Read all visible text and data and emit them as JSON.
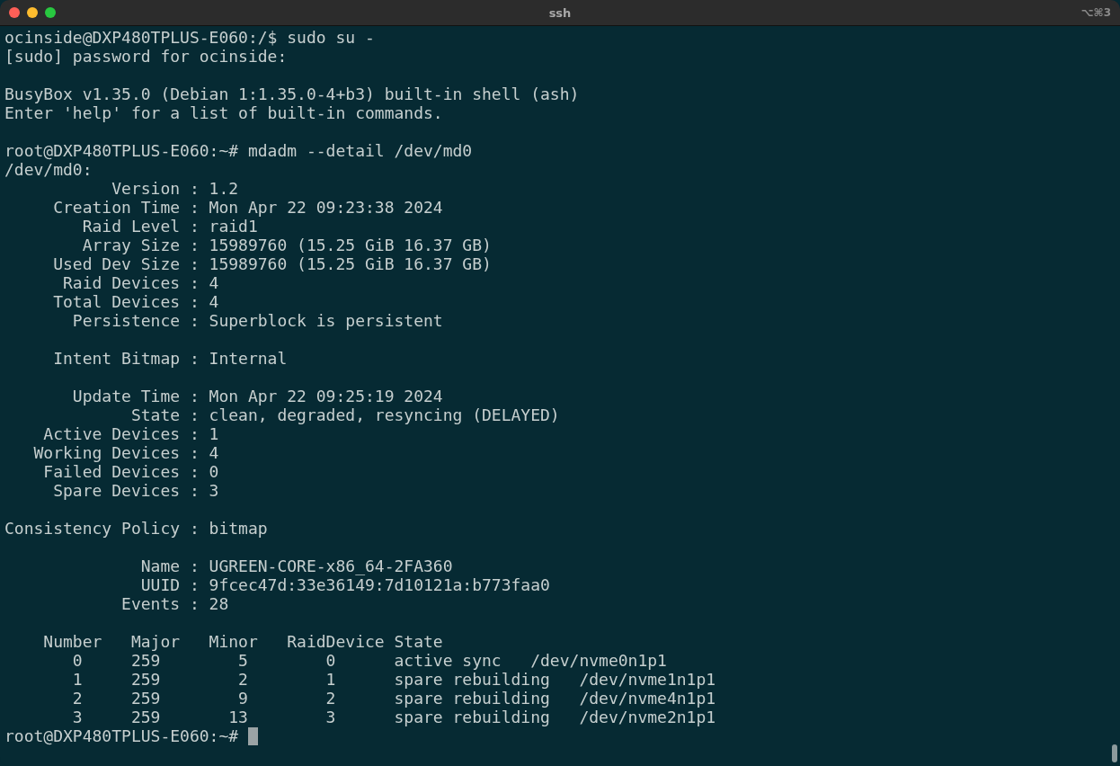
{
  "window": {
    "title": "ssh",
    "shortcut": "⌥⌘3"
  },
  "blocks": [
    {
      "lines": [
        "ocinside@DXP480TPLUS-E060:/$ sudo su -",
        "[sudo] password for ocinside:"
      ]
    },
    {
      "lines": [
        "BusyBox v1.35.0 (Debian 1:1.35.0-4+b3) built-in shell (ash)",
        "Enter 'help' for a list of built-in commands."
      ]
    },
    {
      "lines": [
        "root@DXP480TPLUS-E060:~# mdadm --detail /dev/md0",
        "/dev/md0:",
        "           Version : 1.2",
        "     Creation Time : Mon Apr 22 09:23:38 2024",
        "        Raid Level : raid1",
        "        Array Size : 15989760 (15.25 GiB 16.37 GB)",
        "     Used Dev Size : 15989760 (15.25 GiB 16.37 GB)",
        "      Raid Devices : 4",
        "     Total Devices : 4",
        "       Persistence : Superblock is persistent"
      ]
    },
    {
      "lines": [
        "     Intent Bitmap : Internal"
      ]
    },
    {
      "lines": [
        "       Update Time : Mon Apr 22 09:25:19 2024",
        "             State : clean, degraded, resyncing (DELAYED)",
        "    Active Devices : 1",
        "   Working Devices : 4",
        "    Failed Devices : 0",
        "     Spare Devices : 3"
      ]
    },
    {
      "lines": [
        "Consistency Policy : bitmap"
      ]
    },
    {
      "lines": [
        "              Name : UGREEN-CORE-x86_64-2FA360",
        "              UUID : 9fcec47d:33e36149:7d10121a:b773faa0",
        "            Events : 28"
      ]
    },
    {
      "lines": [
        "    Number   Major   Minor   RaidDevice State",
        "       0     259        5        0      active sync   /dev/nvme0n1p1",
        "       1     259        2        1      spare rebuilding   /dev/nvme1n1p1",
        "       2     259        9        2      spare rebuilding   /dev/nvme4n1p1",
        "       3     259       13        3      spare rebuilding   /dev/nvme2n1p1"
      ]
    }
  ],
  "input_line": {
    "prompt": "root@DXP480TPLUS-E060:~#",
    "cursor": true
  }
}
